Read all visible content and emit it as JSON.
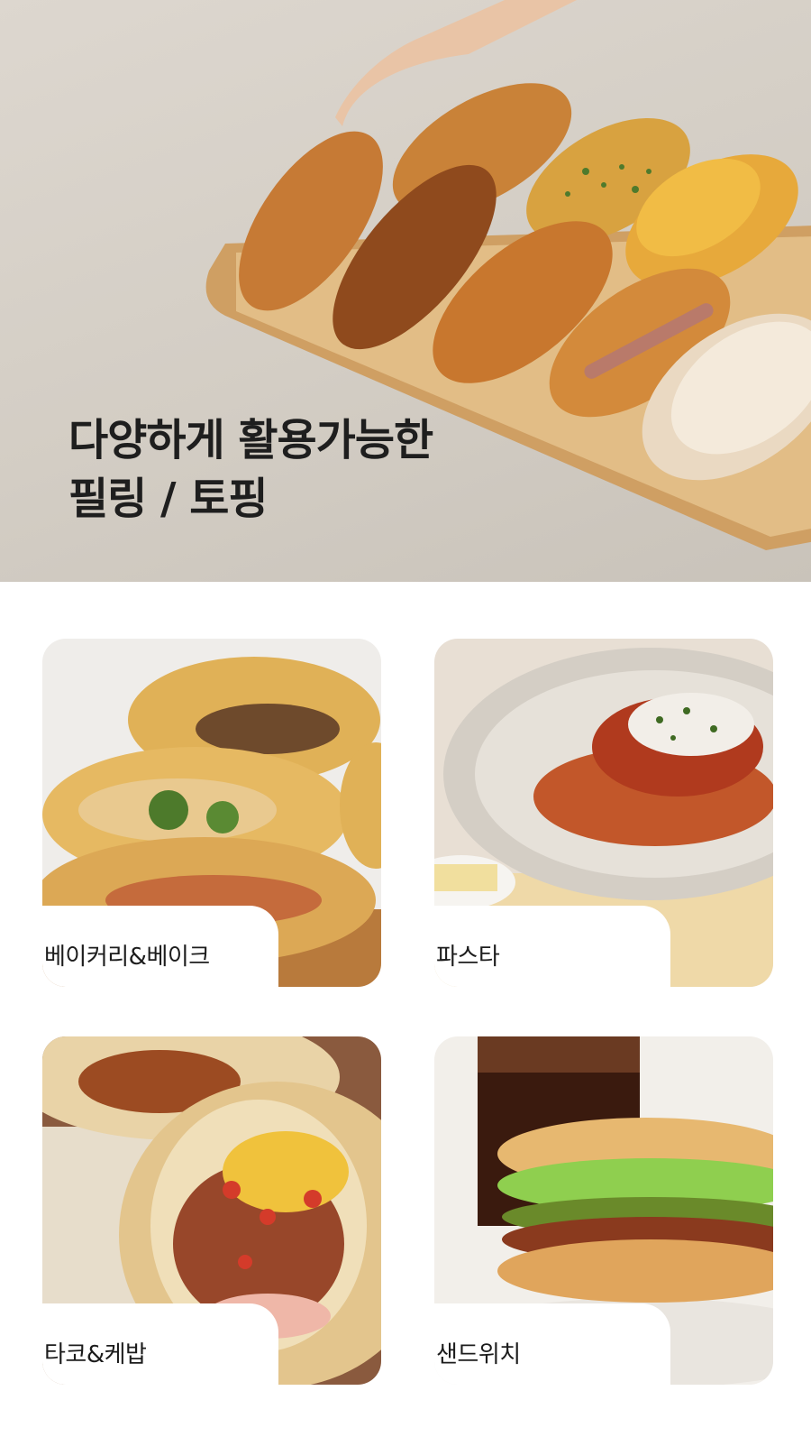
{
  "hero": {
    "title_line1": "다양하게 활용가능한",
    "title_line2": "필링 / 토핑"
  },
  "categories": [
    {
      "label": "베이커리&베이크"
    },
    {
      "label": "파스타"
    },
    {
      "label": "타코&케밥"
    },
    {
      "label": "샌드위치"
    }
  ],
  "colors": {
    "hero_background": "#d6d0c7",
    "tray": "#d9b27a",
    "bread": "#c47a32",
    "text": "#1c1c1c"
  }
}
